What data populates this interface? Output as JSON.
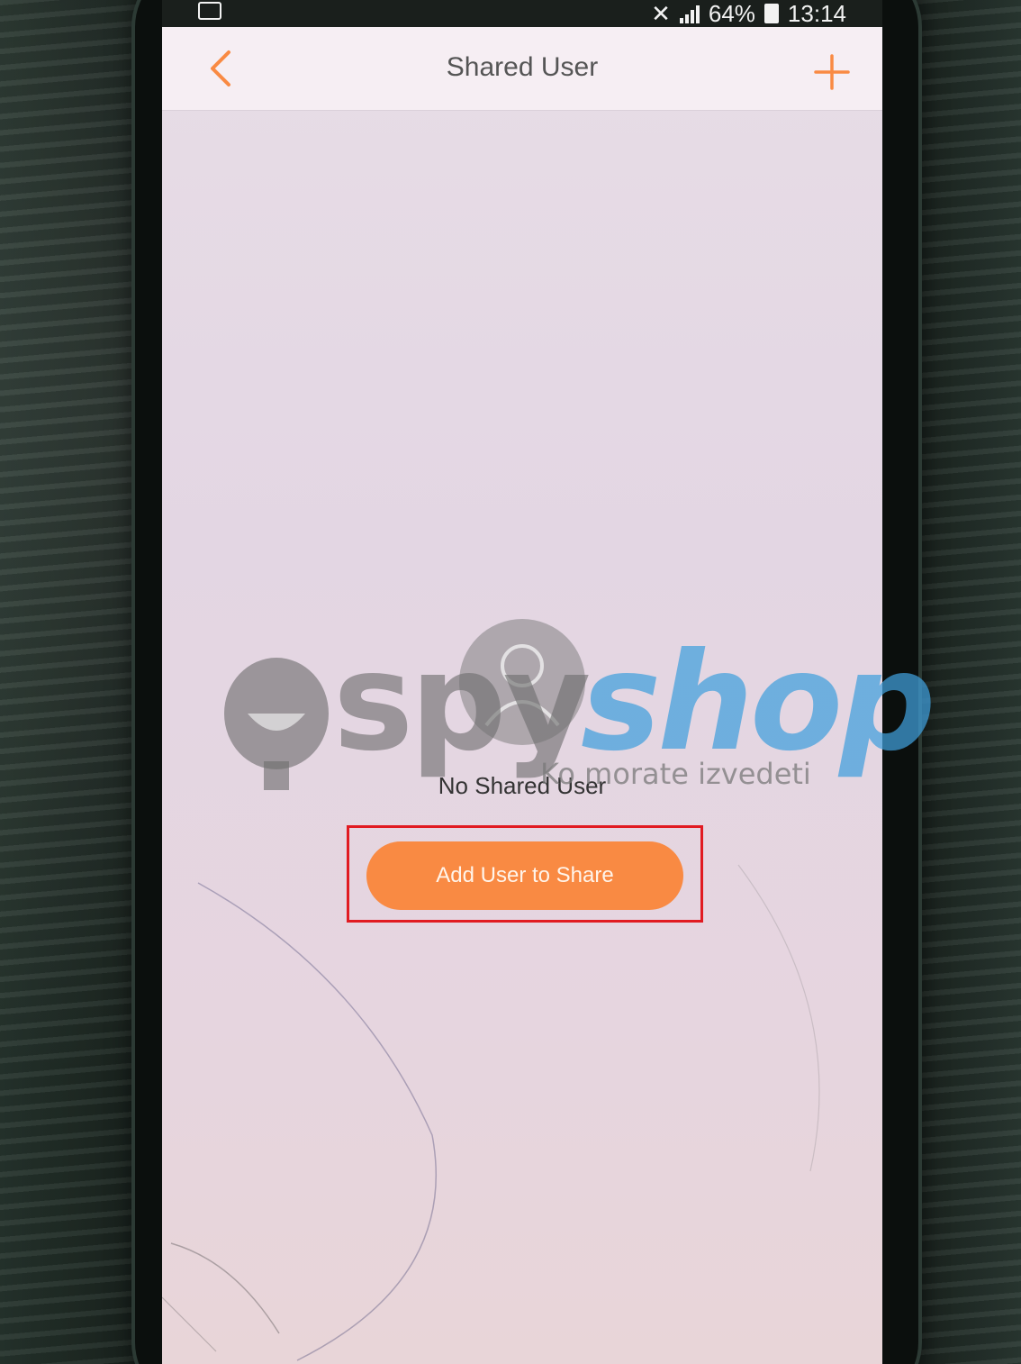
{
  "status_bar": {
    "battery_percent": "64%",
    "time": "13:14"
  },
  "header": {
    "title": "Shared User",
    "back_icon": "chevron-left-icon",
    "add_icon": "plus-icon"
  },
  "empty_state": {
    "icon": "user-icon",
    "message": "No Shared User",
    "button_label": "Add User to Share"
  },
  "watermark": {
    "brand_part1": "spy",
    "brand_part2": "shop",
    "tagline": "Ko morate izvedeti"
  },
  "colors": {
    "accent": "#f98a43",
    "highlight": "#e11b22",
    "background": "#e5d8e3"
  }
}
